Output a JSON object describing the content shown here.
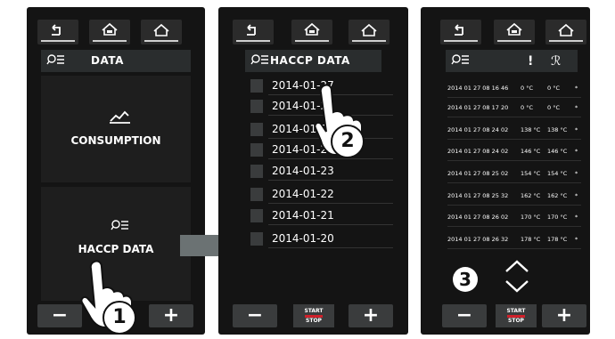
{
  "panel1": {
    "header_title": "DATA",
    "consumption_label": "CONSUMPTION",
    "haccp_label": "HACCP DATA",
    "minus_label": "−",
    "plus_label": "+",
    "step_label": "1"
  },
  "panel2": {
    "header_title": "HACCP DATA",
    "dates": [
      "2014-01-27",
      "2014-01-26",
      "2014-01-25",
      "2014-01-24",
      "2014-01-23",
      "2014-01-22",
      "2014-01-21",
      "2014-01-20"
    ],
    "minus_label": "−",
    "plus_label": "+",
    "start_label": "START",
    "stop_label": "STOP",
    "step_label": "2"
  },
  "panel3": {
    "col_alert": "!",
    "col_probe": "ℛ",
    "rows": [
      {
        "time": "2014 01 27 08 16 46",
        "t1": "0 °C",
        "t2": "0 °C",
        "m": "*"
      },
      {
        "time": "2014 01 27 08 17 20",
        "t1": "0 °C",
        "t2": "0 °C",
        "m": "*"
      },
      {
        "time": "2014 01 27 08 24 02",
        "t1": "138 °C",
        "t2": "138 °C",
        "m": "*"
      },
      {
        "time": "2014 01 27 08 24 02",
        "t1": "146 °C",
        "t2": "146 °C",
        "m": "*"
      },
      {
        "time": "2014 01 27 08 25 02",
        "t1": "154 °C",
        "t2": "154 °C",
        "m": "*"
      },
      {
        "time": "2014 01 27 08 25 32",
        "t1": "162 °C",
        "t2": "162 °C",
        "m": "*"
      },
      {
        "time": "2014 01 27 08 26 02",
        "t1": "170 °C",
        "t2": "170 °C",
        "m": "*"
      },
      {
        "time": "2014 01 27 08 26 32",
        "t1": "178 °C",
        "t2": "178 °C",
        "m": "*"
      }
    ],
    "minus_label": "−",
    "plus_label": "+",
    "start_label": "START",
    "stop_label": "STOP",
    "step_label": "3"
  },
  "icons": [
    "back-icon",
    "home-program-icon",
    "home-icon",
    "search-list-icon",
    "chart-icon",
    "arrow-right-icon",
    "hand-pointer-icon",
    "chevron-up-icon",
    "chevron-down-icon"
  ],
  "colors": {
    "panel": "#141414",
    "button": "#3a3c3d",
    "accent": "#d0202a",
    "arrow": "#6b7273"
  }
}
